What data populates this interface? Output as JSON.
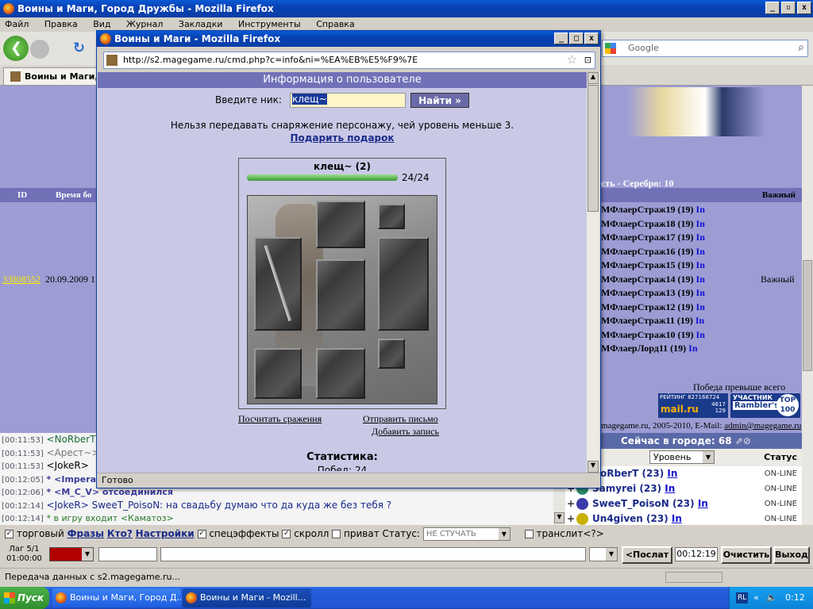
{
  "main_window": {
    "title": "Воины и Маги, Город Дружбы - Mozilla Firefox",
    "menu": [
      "Файл",
      "Правка",
      "Вид",
      "Журнал",
      "Закладки",
      "Инструменты",
      "Справка"
    ],
    "search_placeholder": "Google",
    "tab_label": "Воины и Маги, Г"
  },
  "page": {
    "col_id": "ID",
    "col_time": "Время бо",
    "row_id": "33808552",
    "row_time": "20.09.2009 1",
    "silver": "сть - Серебро: 10",
    "col_important": "Важный",
    "row_important": "Важный",
    "battle_list": [
      {
        "name": "МФлаерСтраж19 (19)",
        "link": "In"
      },
      {
        "name": "МФлаерСтраж18 (19)",
        "link": "In"
      },
      {
        "name": "МФлаерСтраж17 (19)",
        "link": "In"
      },
      {
        "name": "МФлаерСтраж16 (19)",
        "link": "In"
      },
      {
        "name": "МФлаерСтраж15 (19)",
        "link": "In"
      },
      {
        "name": "МФлаерСтраж14 (19)",
        "link": "In"
      },
      {
        "name": "МФлаерСтраж13 (19)",
        "link": "In"
      },
      {
        "name": "МФлаерСтраж12 (19)",
        "link": "In"
      },
      {
        "name": "МФлаерСтраж11 (19)",
        "link": "In"
      },
      {
        "name": "МФлаерСтраж10 (19)",
        "link": "In"
      },
      {
        "name": "МФлаерЛорд11 (19)",
        "link": "In"
      }
    ],
    "victory_text": "Победа превыше всего",
    "rating_badge": {
      "line1": "РЕЙТИНГ 827168724",
      "num1": "4617",
      "num2": "129",
      "brand": "mail.ru"
    },
    "rambler_badge": {
      "line1": "УЧАСТНИК",
      "brand": "Rambler's",
      "top": "TOP",
      "num": "100"
    },
    "copyright": "magegame.ru, 2005-2010, E-Mail: ",
    "email": "admin@magegame.ru"
  },
  "chat": [
    {
      "time": "[00:11:53]",
      "text": "<NoRberT"
    },
    {
      "time": "[00:11:53]",
      "text": "<Арест~>"
    },
    {
      "time": "[00:11:53]",
      "text": "<JokeR>"
    },
    {
      "time": "[00:12:05]",
      "text": "* <Imperato"
    },
    {
      "time": "[00:12:06]",
      "text": "* <M_C_V> отсоединился"
    },
    {
      "time": "[00:12:14]",
      "text": "<JokeR> SweeT_PoisoN: на свадьбу думаю что да куда же без тебя ?"
    },
    {
      "time": "[00:12:14]",
      "text": "* в игру входит <Каматоз>"
    }
  ],
  "online": {
    "header": "Сейчас в городе: 68",
    "sort_select": "Уровень",
    "status_col": "Статус",
    "users": [
      {
        "name": "NoRberT (23)",
        "link": "In",
        "status": "ON-LINE"
      },
      {
        "name": "Samyrei (23)",
        "link": "In",
        "status": "ON-LINE"
      },
      {
        "name": "SweeT_PoisoN (23)",
        "link": "In",
        "status": "ON-LINE"
      },
      {
        "name": "Un4given (23)",
        "link": "In",
        "status": "ON-LINE"
      }
    ]
  },
  "controls": {
    "trade": "торговый",
    "phrases": "Фразы",
    "who": "Кто?",
    "settings": "Настройки",
    "effects": "спецэффекты",
    "scroll": "скролл",
    "private": "приват",
    "status_label": "Статус:",
    "status_value": "НЕ СТУЧАТЬ",
    "translit": "транслит<?>",
    "lag": "Лаг 5/1",
    "lag_time": "01:00:00",
    "send": "<Послат",
    "clock": "00:12:19",
    "clear": "Очистить",
    "exit": "Выход"
  },
  "status_bar": "Передача данных с s2.magegame.ru...",
  "popup": {
    "title": "Воины и Маги - Mozilla Firefox",
    "url": "http://s2.magegame.ru/cmd.php?c=info&ni=%EA%EB%E5%F9%7E",
    "header": "Информация о пользователе",
    "nick_label": "Введите ник:",
    "nick_value": "клещ~",
    "find_button": "Найти »",
    "warning": "Нельзя передавать снаряжение персонажу, чей уровень меньше 3.",
    "gift_link": "Подарить подарок",
    "char_name": "клещ~ (2)",
    "hp": "24/24",
    "hp_fraction": 1.0,
    "count_battles": "Посчитать сражения",
    "send_letter": "Отправить письмо",
    "add_note": "Добавить запись",
    "stats_title": "Статистика:",
    "stats_partial": "Побед: 24",
    "status": "Готово"
  },
  "taskbar": {
    "start": "Пуск",
    "tasks": [
      "Воины и Маги, Город Д...",
      "Воины и Маги - Mozill..."
    ],
    "lang": "RL",
    "clock": "0:12"
  }
}
